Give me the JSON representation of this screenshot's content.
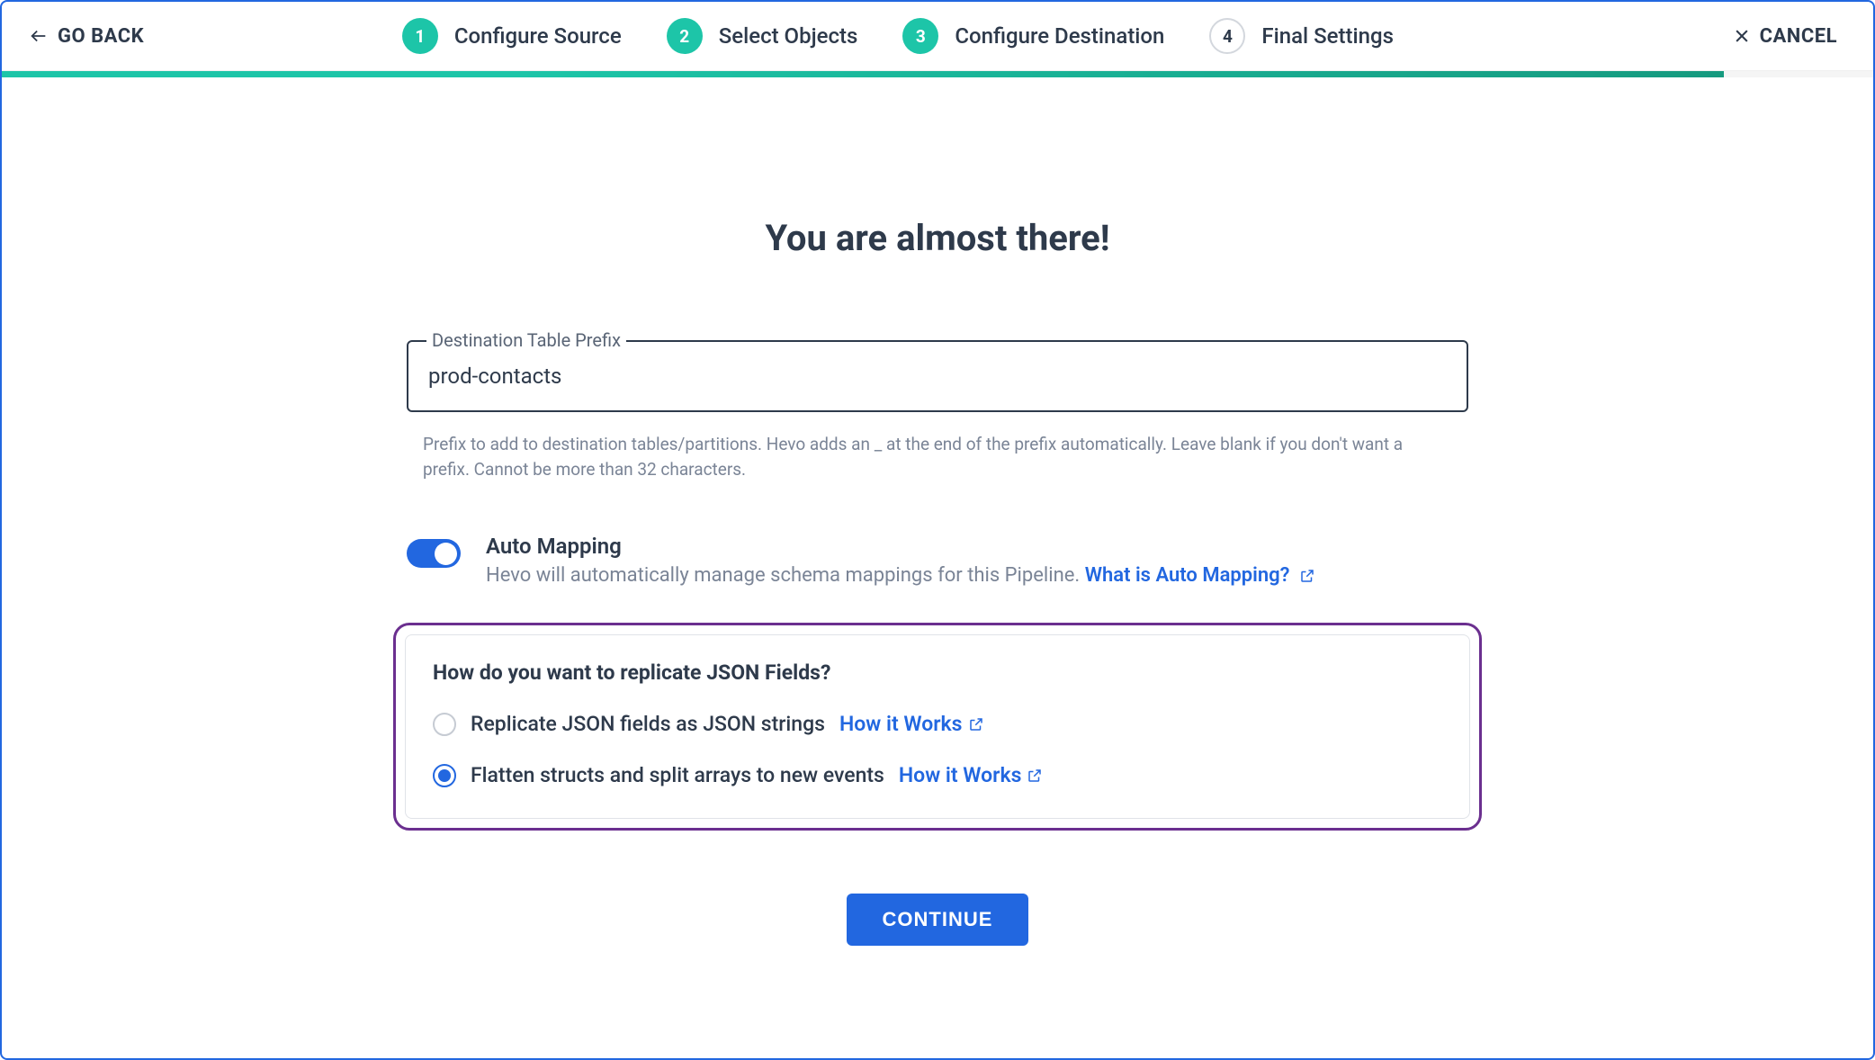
{
  "header": {
    "go_back": "GO BACK",
    "cancel": "CANCEL",
    "steps": [
      {
        "num": "1",
        "label": "Configure Source",
        "active": true
      },
      {
        "num": "2",
        "label": "Select Objects",
        "active": true
      },
      {
        "num": "3",
        "label": "Configure Destination",
        "active": true
      },
      {
        "num": "4",
        "label": "Final Settings",
        "active": false
      }
    ]
  },
  "main": {
    "title": "You are almost there!",
    "prefix_field": {
      "label": "Destination Table Prefix",
      "value": "prod-contacts",
      "helper": "Prefix to add to destination tables/partitions. Hevo adds an _ at the end of the prefix automatically. Leave blank if you don't want a prefix. Cannot be more than 32 characters."
    },
    "auto_mapping": {
      "title": "Auto Mapping",
      "desc": "Hevo will automatically manage schema mappings for this Pipeline. ",
      "link": "What is Auto Mapping?",
      "enabled": true
    },
    "json_panel": {
      "title": "How do you want to replicate JSON Fields?",
      "options": [
        {
          "label": "Replicate JSON fields as JSON strings",
          "link": "How it Works",
          "checked": false
        },
        {
          "label": "Flatten structs and split arrays to new events",
          "link": "How it Works",
          "checked": true
        }
      ]
    },
    "continue": "CONTINUE"
  }
}
